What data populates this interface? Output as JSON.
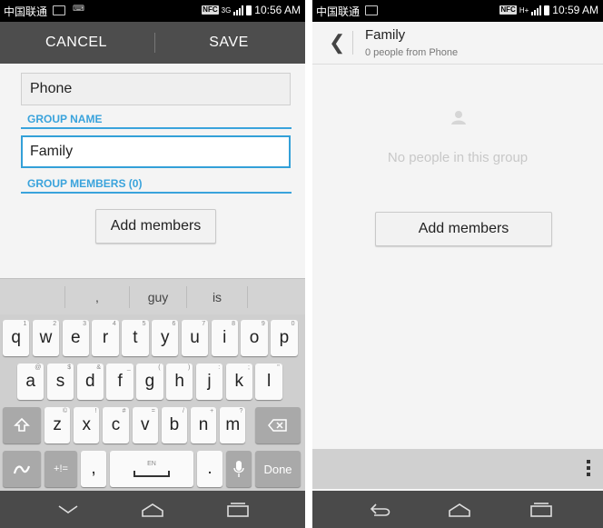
{
  "left": {
    "status": {
      "carrier": "中国联通",
      "nfc": "NFC",
      "network": "3G",
      "time": "10:56 AM"
    },
    "toolbar": {
      "cancel_label": "CANCEL",
      "save_label": "SAVE"
    },
    "account_field": {
      "value": "Phone"
    },
    "group_name": {
      "label": "GROUP NAME",
      "value": "Family"
    },
    "group_members": {
      "label": "GROUP MEMBERS (0)"
    },
    "add_members_label": "Add members",
    "keyboard": {
      "suggestions": [
        ",",
        "guy",
        "is"
      ],
      "row1": [
        {
          "k": "q",
          "h": "1"
        },
        {
          "k": "w",
          "h": "2"
        },
        {
          "k": "e",
          "h": "3"
        },
        {
          "k": "r",
          "h": "4"
        },
        {
          "k": "t",
          "h": "5"
        },
        {
          "k": "y",
          "h": "6"
        },
        {
          "k": "u",
          "h": "7"
        },
        {
          "k": "i",
          "h": "8"
        },
        {
          "k": "o",
          "h": "9"
        },
        {
          "k": "p",
          "h": "0"
        }
      ],
      "row2": [
        {
          "k": "a",
          "h": "@"
        },
        {
          "k": "s",
          "h": "$"
        },
        {
          "k": "d",
          "h": "&"
        },
        {
          "k": "f",
          "h": "_"
        },
        {
          "k": "g",
          "h": "("
        },
        {
          "k": "h",
          "h": ")"
        },
        {
          "k": "j",
          "h": ":"
        },
        {
          "k": "k",
          "h": ";"
        },
        {
          "k": "l",
          "h": "\""
        }
      ],
      "row3": [
        {
          "k": "z",
          "h": "©"
        },
        {
          "k": "x",
          "h": "!"
        },
        {
          "k": "c",
          "h": "#"
        },
        {
          "k": "v",
          "h": "="
        },
        {
          "k": "b",
          "h": "/"
        },
        {
          "k": "n",
          "h": "+"
        },
        {
          "k": "m",
          "h": "?"
        }
      ],
      "symbols_label": "+!=",
      "comma": ",",
      "space_label": "EN",
      "period": ".",
      "done_label": "Done"
    }
  },
  "right": {
    "status": {
      "carrier": "中国联通",
      "nfc": "NFC",
      "network": "H+",
      "time": "10:59 AM"
    },
    "title": "Family",
    "subtitle": "0 people from Phone",
    "empty_text": "No people in this group",
    "add_members_label": "Add members"
  },
  "colors": {
    "accent": "#3aa3dc",
    "actionbar": "#4d4d4d",
    "navbar": "#4a4a4a"
  },
  "icons": [
    "gallery-icon",
    "signal-icon",
    "battery-icon",
    "back-icon",
    "person-icon",
    "shift-icon",
    "backspace-icon",
    "swipe-icon",
    "mic-icon",
    "overflow-menu-icon",
    "nav-back-icon",
    "nav-home-icon",
    "nav-recents-icon",
    "keyboard-hide-icon"
  ]
}
